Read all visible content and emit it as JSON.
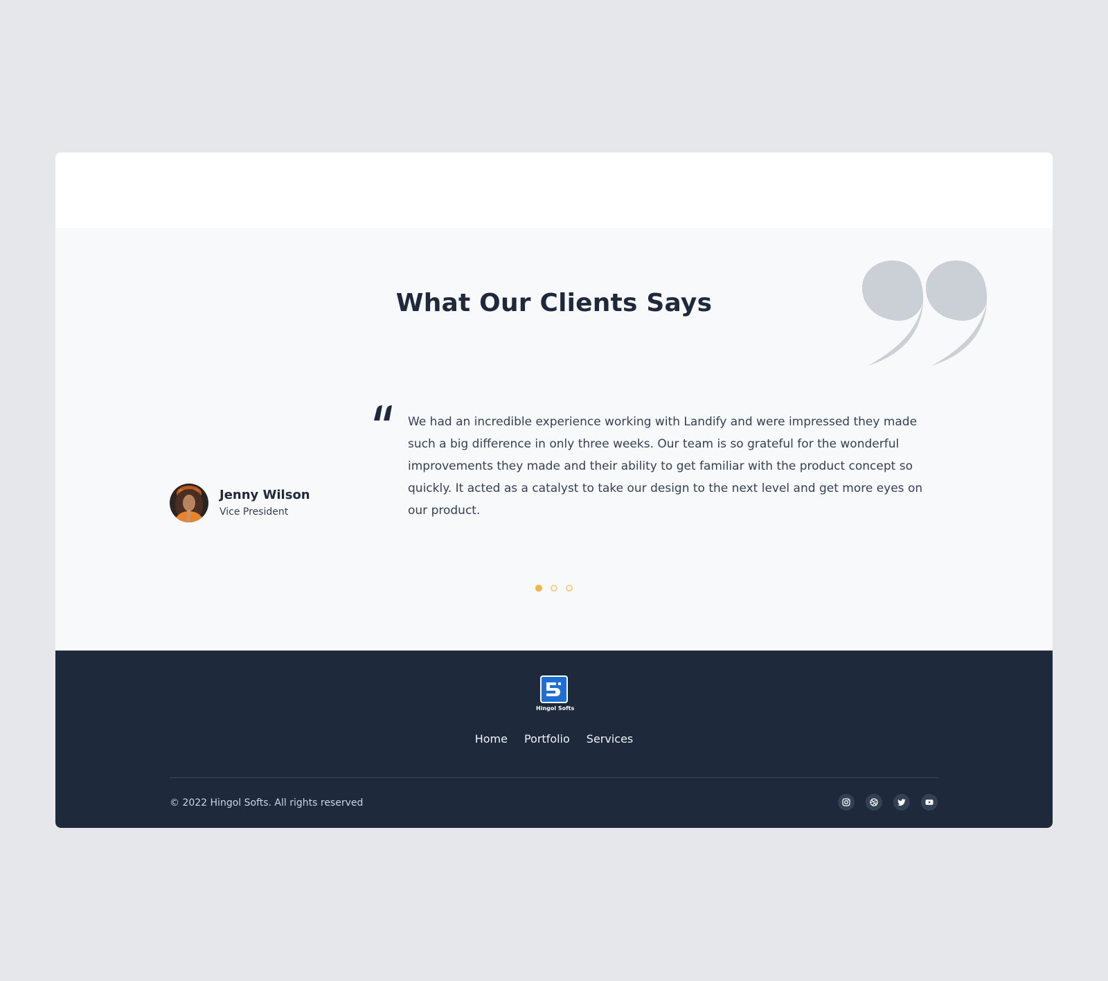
{
  "testimonials": {
    "title": "What Our Clients Says",
    "client": {
      "name": "Jenny Wilson",
      "role": "Vice President"
    },
    "quote": "We had an incredible experience working with Landify and were impressed they made such a big difference in only three weeks. Our team is so grateful for the wonderful improvements they made and their ability to get familiar with the product concept so quickly. It acted as a catalyst to take our design to the next level and get more eyes on our product.",
    "slider": {
      "count": 3,
      "active_index": 0
    }
  },
  "footer": {
    "logo_text": "Hingol Softs",
    "nav": [
      "Home",
      "Portfolio",
      "Services"
    ],
    "copyright": "© 2022 Hingol Softs. All rights reserved",
    "social_icons": [
      "instagram-icon",
      "dribbble-icon",
      "twitter-icon",
      "youtube-icon"
    ]
  },
  "colors": {
    "page_bg": "#e5e7eb",
    "section_bg": "#f8f9fb",
    "footer_bg": "#1e293b",
    "heading": "#1e293b",
    "accent": "#f0b64a",
    "quote_mark": "#cbcfd6",
    "logo_blue": "#1f6ed4"
  }
}
